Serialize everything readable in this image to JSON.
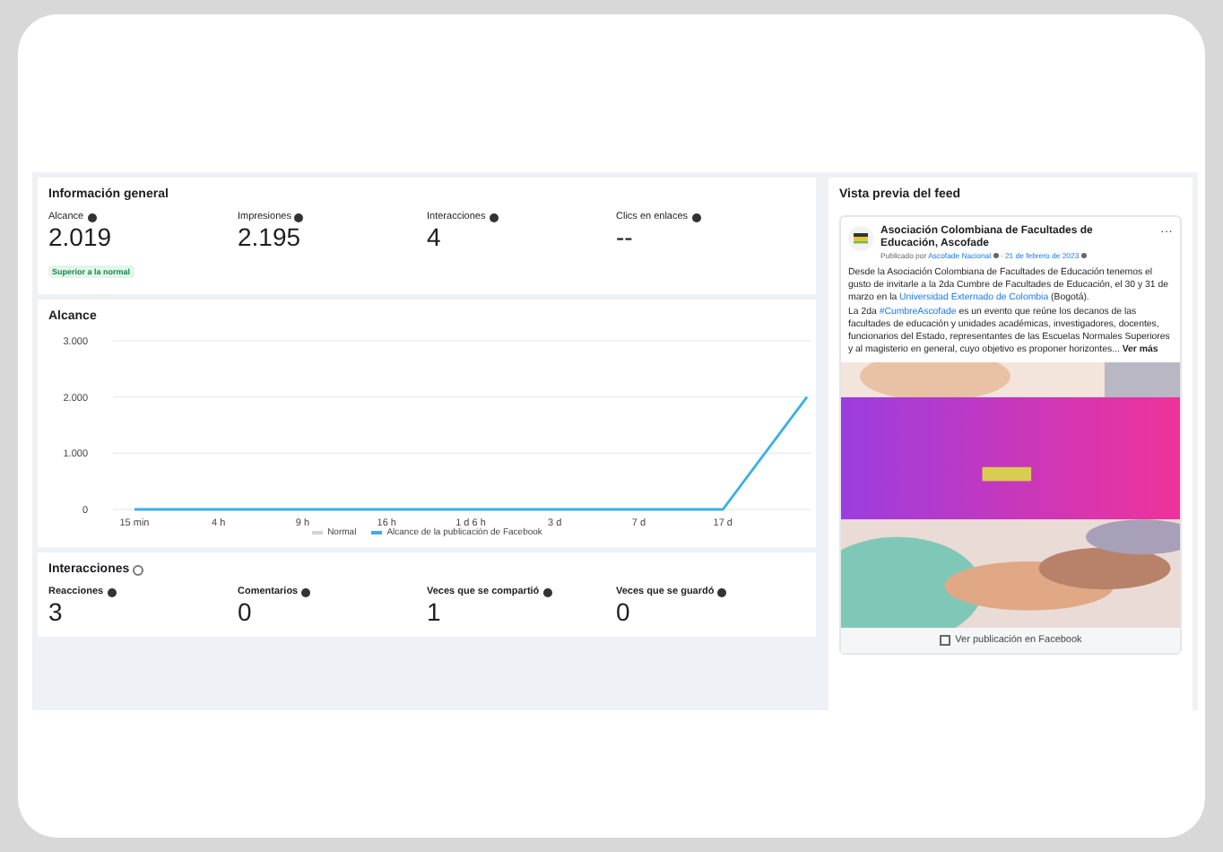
{
  "overview": {
    "title": "Información general",
    "metrics": [
      {
        "label": "Alcance",
        "value": "2.019",
        "badge": "Superior a la normal"
      },
      {
        "label": "Impresiones",
        "value": "2.195"
      },
      {
        "label": "Interacciones",
        "value": "4"
      },
      {
        "label": "Clics en enlaces",
        "value": "--"
      }
    ]
  },
  "reach": {
    "title": "Alcance",
    "chart_data": {
      "type": "line",
      "categories": [
        "15 min",
        "4 h",
        "9 h",
        "16 h",
        "1 d 6 h",
        "3 d",
        "7 d",
        "17 d",
        null
      ],
      "yticks": [
        {
          "value": 0,
          "label": "0"
        },
        {
          "value": 1000,
          "label": "1.000"
        },
        {
          "value": 2000,
          "label": "2.000"
        },
        {
          "value": 3000,
          "label": "3.000"
        }
      ],
      "ylim": [
        0,
        3000
      ],
      "series": [
        {
          "name": "Normal",
          "color": "#d0d3d8",
          "values": [
            null,
            null,
            null,
            null,
            null,
            null,
            null,
            null,
            null
          ]
        },
        {
          "name": "Alcance de la publicación de Facebook",
          "color": "#3ab0e6",
          "values": [
            0,
            0,
            0,
            0,
            0,
            0,
            0,
            0,
            2000
          ]
        }
      ]
    }
  },
  "interactions": {
    "title": "Interacciones",
    "metrics": [
      {
        "label": "Reacciones",
        "value": "3"
      },
      {
        "label": "Comentarios",
        "value": "0"
      },
      {
        "label": "Veces que se compartió",
        "value": "1"
      },
      {
        "label": "Veces que se guardó",
        "value": "0"
      }
    ]
  },
  "feed_preview": {
    "title": "Vista previa del feed",
    "post": {
      "page_name": "Asociación Colombiana de Facultades de Educación, Ascofade",
      "more": "···",
      "published_by": "Publicado por",
      "author": "Ascofade Nacional",
      "date": "21 de febrero de 2023",
      "separator": "·",
      "paragraphs": [
        [
          {
            "kind": "text",
            "text": "Desde la Asociación Colombiana de Facultades de Educación tenemos el gusto de invitarle a la 2da Cumbre de Facultades de Educación, el 30 y 31 de marzo en la "
          },
          {
            "kind": "link",
            "text": "Universidad Externado de Colombia"
          },
          {
            "kind": "text",
            "text": " (Bogotá)."
          }
        ],
        [
          {
            "kind": "text",
            "text": "La 2da "
          },
          {
            "kind": "link",
            "text": "#CumbreAscofade"
          },
          {
            "kind": "text",
            "text": " es un evento que reúne los decanos de las facultades de educación y unidades académicas, investigadores, docentes, funcionarios del Estado, representantes de las Escuelas Normales Superiores y al magisterio en general, cuyo objetivo es proponer horizontes... **Ver más**"
          }
        ]
      ],
      "image": {
        "kind": "picture"
      },
      "view_link": "Ver publicación en Facebook"
    }
  }
}
